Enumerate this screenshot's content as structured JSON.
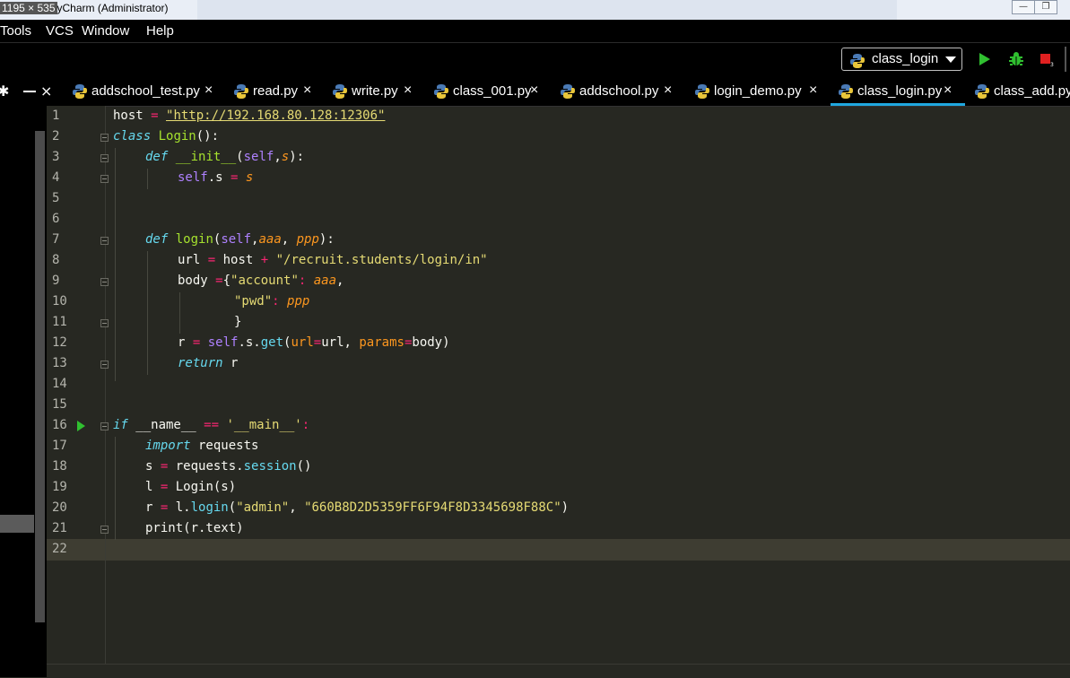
{
  "window": {
    "title": "1195 × 535 PyCharm (Administrator)",
    "overlay_text": "1195 × 535",
    "title_text": "yCharm (Administrator)"
  },
  "menu": {
    "items": [
      {
        "label": "Tools"
      },
      {
        "label": "VCS"
      },
      {
        "label": "Window"
      },
      {
        "label": "Help"
      }
    ]
  },
  "toolbar": {
    "run_config": "class_login",
    "run_icon": "play-icon",
    "debug_icon": "bug-icon",
    "stop_icon": "stop-icon"
  },
  "tabs": [
    {
      "label": "addschool_test.py"
    },
    {
      "label": "read.py"
    },
    {
      "label": "write.py"
    },
    {
      "label": "class_001.py"
    },
    {
      "label": "addschool.py"
    },
    {
      "label": "login_demo.py"
    },
    {
      "label": "class_login.py",
      "active": true
    },
    {
      "label": "class_add.py"
    }
  ],
  "editor": {
    "line_numbers": [
      "1",
      "2",
      "3",
      "4",
      "5",
      "6",
      "7",
      "8",
      "9",
      "10",
      "11",
      "12",
      "13",
      "14",
      "15",
      "16",
      "17",
      "18",
      "19",
      "20",
      "21",
      "22"
    ],
    "current_line": "22",
    "code": {
      "l1_host": "host",
      "l1_eq": " = ",
      "l1_url": "\"http://192.168.80.128:12306\"",
      "l2_class": "class",
      "l2_name": " Login",
      "l2_rest": "():",
      "l3_def": "def",
      "l3_name": " __init__",
      "l3_open": "(",
      "l3_self": "self",
      "l3_comma": ",",
      "l3_s": "s",
      "l3_close": "):",
      "l4_self": "self",
      "l4_attr": ".s",
      "l4_eq": " = ",
      "l4_s": "s",
      "l7_def": "def",
      "l7_name": " login",
      "l7_open": "(",
      "l7_self": "self",
      "l7_comma": ",",
      "l7_aaa": "aaa",
      "l7_comma2": ", ",
      "l7_ppp": "ppp",
      "l7_close": "):",
      "l8_a": "url",
      "l8_eq": " = ",
      "l8_host": "host",
      "l8_plus": " + ",
      "l8_str": "\"/recruit.students/login/in\"",
      "l9_body": "body ",
      "l9_eq": "=",
      "l9_brace": "{",
      "l9_key": "\"account\"",
      "l9_colon": ": ",
      "l9_val": "aaa",
      "l9_comma": ",",
      "l10_key": "\"pwd\"",
      "l10_colon": ": ",
      "l10_val": "ppp",
      "l11_brace": "}",
      "l12_r": "r",
      "l12_eq": " = ",
      "l12_self": "self",
      "l12_s": ".s.",
      "l12_get": "get",
      "l12_open": "(",
      "l12_kw1": "url",
      "l12_eq1": "=",
      "l12_v1": "url, ",
      "l12_kw2": "params",
      "l12_eq2": "=",
      "l12_v2": "body)",
      "l13_ret": "return",
      "l13_r": " r",
      "l16_if": "if",
      "l16_name": " __name__ ",
      "l16_eqeq": "==",
      "l16_str": " '__main__'",
      "l16_colon": ":",
      "l17_import": "import",
      "l17_mod": " requests",
      "l18_s": "s",
      "l18_eq": " = ",
      "l18_req": "requests.",
      "l18_fn": "session",
      "l18_paren": "()",
      "l19_l": "l",
      "l19_eq": " = ",
      "l19_rest": "Login(s)",
      "l20_r": "r",
      "l20_eq": " = ",
      "l20_l": "l.",
      "l20_fn": "login",
      "l20_open": "(",
      "l20_s1": "\"admin\"",
      "l20_comma": ", ",
      "l20_s2": "\"660B8D2D5359FF6F94F8D3345698F88C\"",
      "l20_close": ")",
      "l21": "print(r.text)"
    }
  },
  "colors": {
    "editor_bg": "#272822",
    "keyword": "#66d9ef",
    "string": "#e6db74",
    "operator": "#f92672",
    "self": "#ae81ff",
    "param": "#fd971f",
    "active_tab_underline": "#20a8e0",
    "run_green": "#30c030",
    "stop_red": "#e02020"
  }
}
